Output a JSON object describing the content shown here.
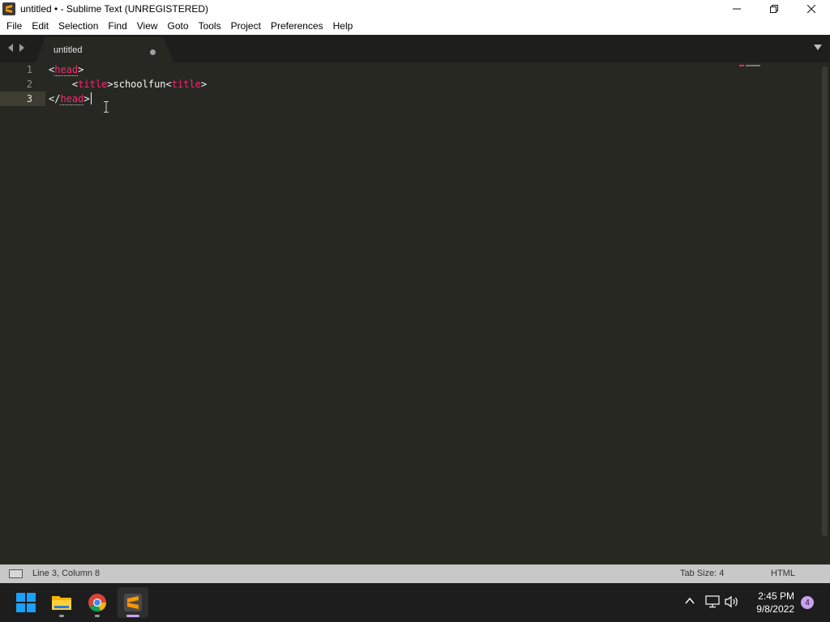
{
  "window": {
    "title": "untitled • - Sublime Text (UNREGISTERED)",
    "controls": [
      "minimize",
      "restore",
      "close"
    ]
  },
  "menu": {
    "items": [
      "File",
      "Edit",
      "Selection",
      "Find",
      "View",
      "Goto",
      "Tools",
      "Project",
      "Preferences",
      "Help"
    ]
  },
  "tabs": [
    {
      "label": "untitled",
      "modified": true,
      "active": true
    }
  ],
  "editor": {
    "line_numbers": [
      "1",
      "2",
      "3"
    ],
    "active_line": 3,
    "lines": [
      {
        "indent": "",
        "tokens": [
          [
            "punct",
            "<"
          ],
          [
            "tag",
            "head"
          ],
          [
            "punct",
            ">"
          ]
        ]
      },
      {
        "indent": "    ",
        "tokens": [
          [
            "punct",
            "<"
          ],
          [
            "tag",
            "title"
          ],
          [
            "punct",
            ">"
          ],
          [
            "txt",
            "schoolfun"
          ],
          [
            "punct",
            "<"
          ],
          [
            "tag",
            "title"
          ],
          [
            "punct",
            ">"
          ]
        ]
      },
      {
        "indent": "",
        "tokens": [
          [
            "punct",
            "</"
          ],
          [
            "tag",
            "head"
          ],
          [
            "punct",
            ">"
          ]
        ]
      }
    ],
    "colors": {
      "background": "#272822",
      "tag": "#f92672",
      "text": "#f8f8f2",
      "gutter": "#8f908a"
    }
  },
  "status": {
    "position": "Line 3, Column 8",
    "tab_size": "Tab Size: 4",
    "syntax": "HTML"
  },
  "taskbar": {
    "apps": [
      "start-icon",
      "file-explorer-icon",
      "chrome-icon",
      "sublime-text-icon"
    ],
    "clock_time": "2:45 PM",
    "clock_date": "9/8/2022",
    "notification_count": "4"
  }
}
